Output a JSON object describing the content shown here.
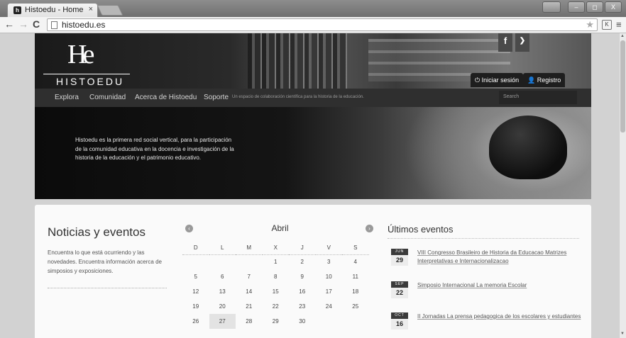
{
  "browser": {
    "tab_title": "Histoedu - Home",
    "tab_close": "×",
    "favicon_letter": "h",
    "url": "histoedu.es",
    "win_min": "–",
    "win_max": "◻",
    "win_close": "X",
    "ext_label": "K"
  },
  "header": {
    "logo_text": "HISTOEDU",
    "social_facebook": "f",
    "social_twitter": "❯",
    "login_label": "⏻ Iniciar sesión",
    "register_label": "👤 Registro"
  },
  "nav": {
    "items": [
      "Explora",
      "Comunidad",
      "Acerca de Histoedu",
      "Soporte"
    ],
    "tagline": "Un espacio de colaboración científica para la historia de la educación.",
    "search_placeholder": "Search"
  },
  "hero": {
    "text": "Histoedu es la primera red social vertical, para la participación de la comunidad educativa en la docencia e investigación de la historia de la educación y el patrimonio educativo."
  },
  "noticias": {
    "title": "Noticias y eventos",
    "description": "Encuentra lo que está ocurriendo y las novedades. Encuentra información acerca de simposios y exposiciones."
  },
  "calendar": {
    "month": "Abril",
    "weekdays": [
      "D",
      "L",
      "M",
      "X",
      "J",
      "V",
      "S"
    ],
    "weeks": [
      [
        "",
        "",
        "",
        "1",
        "2",
        "3",
        "4"
      ],
      [
        "5",
        "6",
        "7",
        "8",
        "9",
        "10",
        "11"
      ],
      [
        "12",
        "13",
        "14",
        "15",
        "16",
        "17",
        "18"
      ],
      [
        "19",
        "20",
        "21",
        "22",
        "23",
        "24",
        "25"
      ],
      [
        "26",
        "27",
        "28",
        "29",
        "30",
        "",
        ""
      ]
    ],
    "today": "27"
  },
  "eventos": {
    "title": "Últimos eventos",
    "items": [
      {
        "month": "JUN",
        "day": "29",
        "title": "VIII Congresso Brasileiro de Historia da Educacao Matrizes Interpretativas e Internacionalizacao"
      },
      {
        "month": "SEP",
        "day": "22",
        "title": "Simposio Internacional La memoria Escolar"
      },
      {
        "month": "OCT",
        "day": "16",
        "title": "II Jornadas La prensa pedagogica de los escolares y estudiantes"
      }
    ]
  }
}
